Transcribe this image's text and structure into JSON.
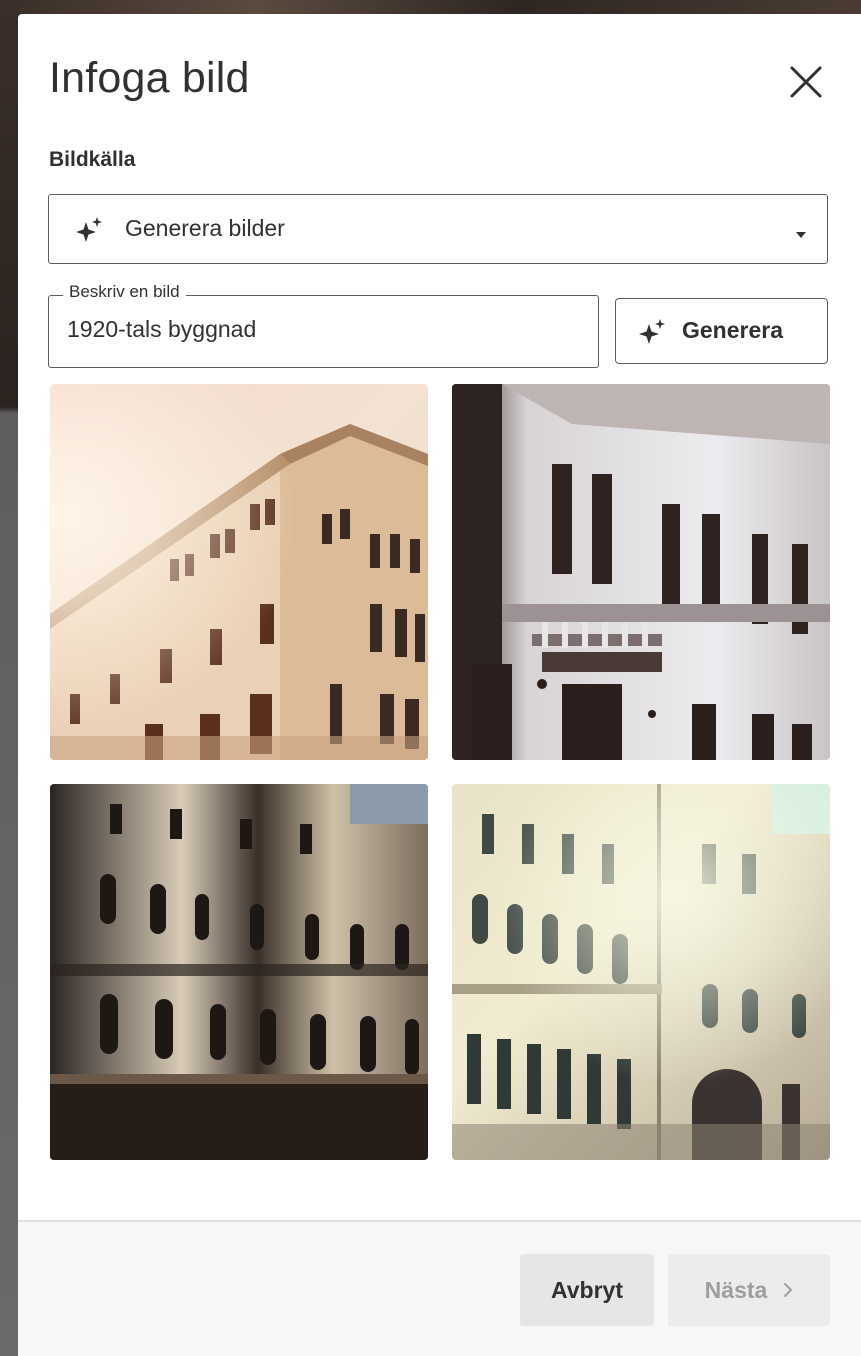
{
  "dialog": {
    "title": "Infoga bild",
    "close_icon": "close-icon"
  },
  "source": {
    "label": "Bildkälla",
    "selected": "Generera bilder",
    "icon": "sparkle-icon"
  },
  "prompt": {
    "label": "Beskriv en bild",
    "value": "1920-tals byggnad"
  },
  "generate_button": {
    "label": "Generera",
    "icon": "sparkle-icon"
  },
  "images": [
    {
      "name": "generated-image-1"
    },
    {
      "name": "generated-image-2"
    },
    {
      "name": "generated-image-3"
    },
    {
      "name": "generated-image-4"
    }
  ],
  "footer": {
    "cancel_label": "Avbryt",
    "next_label": "Nästa",
    "next_icon": "chevron-right-icon"
  },
  "colors": {
    "text": "#323130",
    "border": "#605e5c",
    "disabled_text": "#a19f9d",
    "footer_bg": "#f7f7f7"
  }
}
